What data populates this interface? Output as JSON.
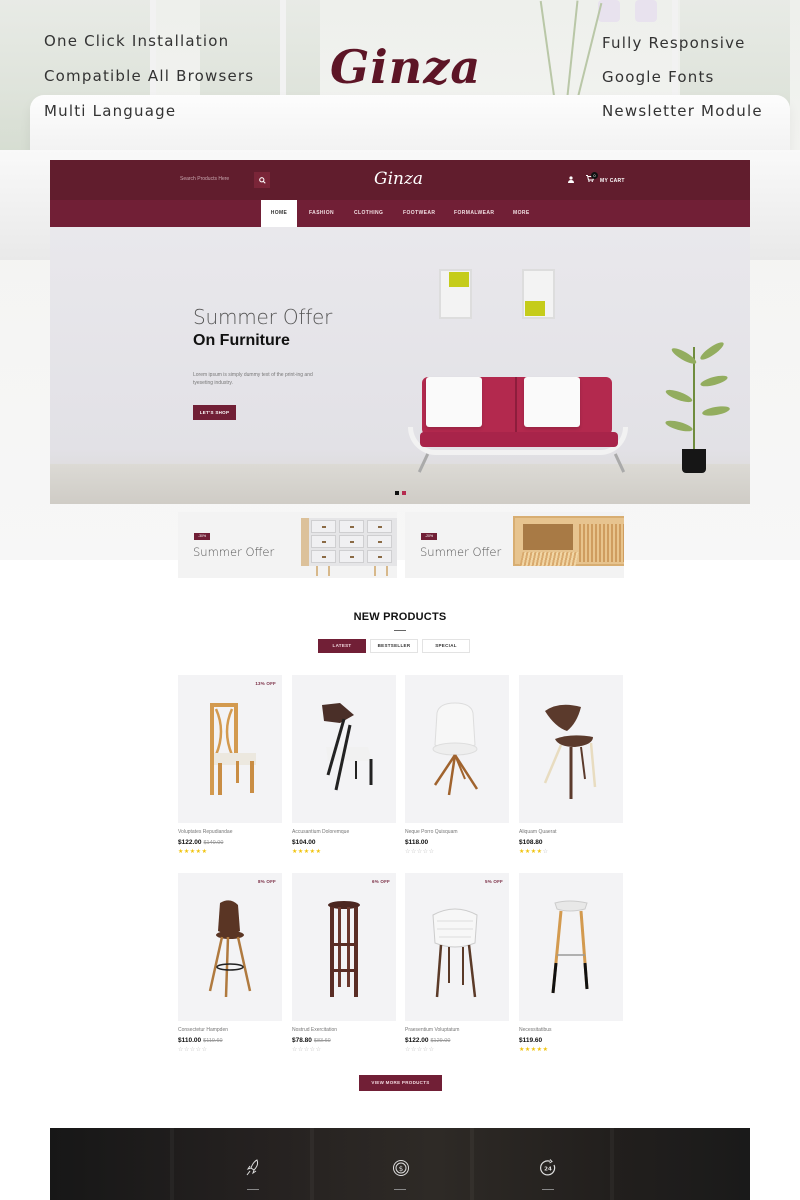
{
  "promo": {
    "brand": "Ginza",
    "features_left": [
      "One Click Installation",
      "Compatible All Browsers",
      "Multi Language"
    ],
    "features_right": [
      "Fully Responsive",
      "Google Fonts",
      "Newsletter Module"
    ]
  },
  "header": {
    "search_placeholder": "Search Products Here",
    "search_icon": "search-icon",
    "logo": "Ginza",
    "user_icon": "user-icon",
    "cart_icon": "cart-icon",
    "cart_count": "0",
    "cart_label": "MY CART"
  },
  "nav": {
    "items": [
      "HOME",
      "FASHION",
      "CLOTHING",
      "FOOTWEAR",
      "FORMALWEAR",
      "MORE"
    ],
    "active": "HOME"
  },
  "hero": {
    "title_light": "Summer Offer",
    "title_bold": "On Furniture",
    "description": "Lorem ipsum is simply dummy text of the print-ing and tyeseting industry.",
    "cta": "LET'S SHOP",
    "slides": 2,
    "active_slide": 2
  },
  "banners": [
    {
      "badge": "-30%",
      "title": "Summer Offer"
    },
    {
      "badge": "-20%",
      "title": "Summer Offer"
    }
  ],
  "products_section": {
    "title": "NEW PRODUCTS",
    "tabs": [
      "LATEST",
      "BESTSELLER",
      "SPECIAL"
    ],
    "active_tab": "LATEST",
    "view_more": "VIEW MORE PRODUCTS"
  },
  "products": [
    {
      "name": "Voluptates Repudiandae",
      "price": "$122.00",
      "old_price": "$140.00",
      "discount": "13% OFF",
      "rating": 5
    },
    {
      "name": "Accusantium Doloremque",
      "price": "$104.00",
      "old_price": "",
      "discount": "",
      "rating": 5
    },
    {
      "name": "Neque Porro Quisquam",
      "price": "$118.00",
      "old_price": "",
      "discount": "",
      "rating": 0
    },
    {
      "name": "Aliquam Quaerat",
      "price": "$108.80",
      "old_price": "",
      "discount": "",
      "rating": 4
    },
    {
      "name": "Consectetur Hampden",
      "price": "$110.00",
      "old_price": "$119.60",
      "discount": "8% OFF",
      "rating": 0
    },
    {
      "name": "Nostrud Exercitation",
      "price": "$78.80",
      "old_price": "$83.60",
      "discount": "6% OFF",
      "rating": 0
    },
    {
      "name": "Praesentium Voluptatum",
      "price": "$122.00",
      "old_price": "$129.00",
      "discount": "5% OFF",
      "rating": 0
    },
    {
      "name": "Necessitatibus",
      "price": "$119.60",
      "old_price": "",
      "discount": "",
      "rating": 5
    }
  ],
  "services": [
    {
      "icon": "rocket-icon"
    },
    {
      "icon": "money-icon"
    },
    {
      "icon": "support-24-icon",
      "text": "24"
    }
  ],
  "colors": {
    "brand": "#611d2d",
    "nav": "#711f36",
    "accent": "#711f36",
    "star": "#f1c40f"
  }
}
